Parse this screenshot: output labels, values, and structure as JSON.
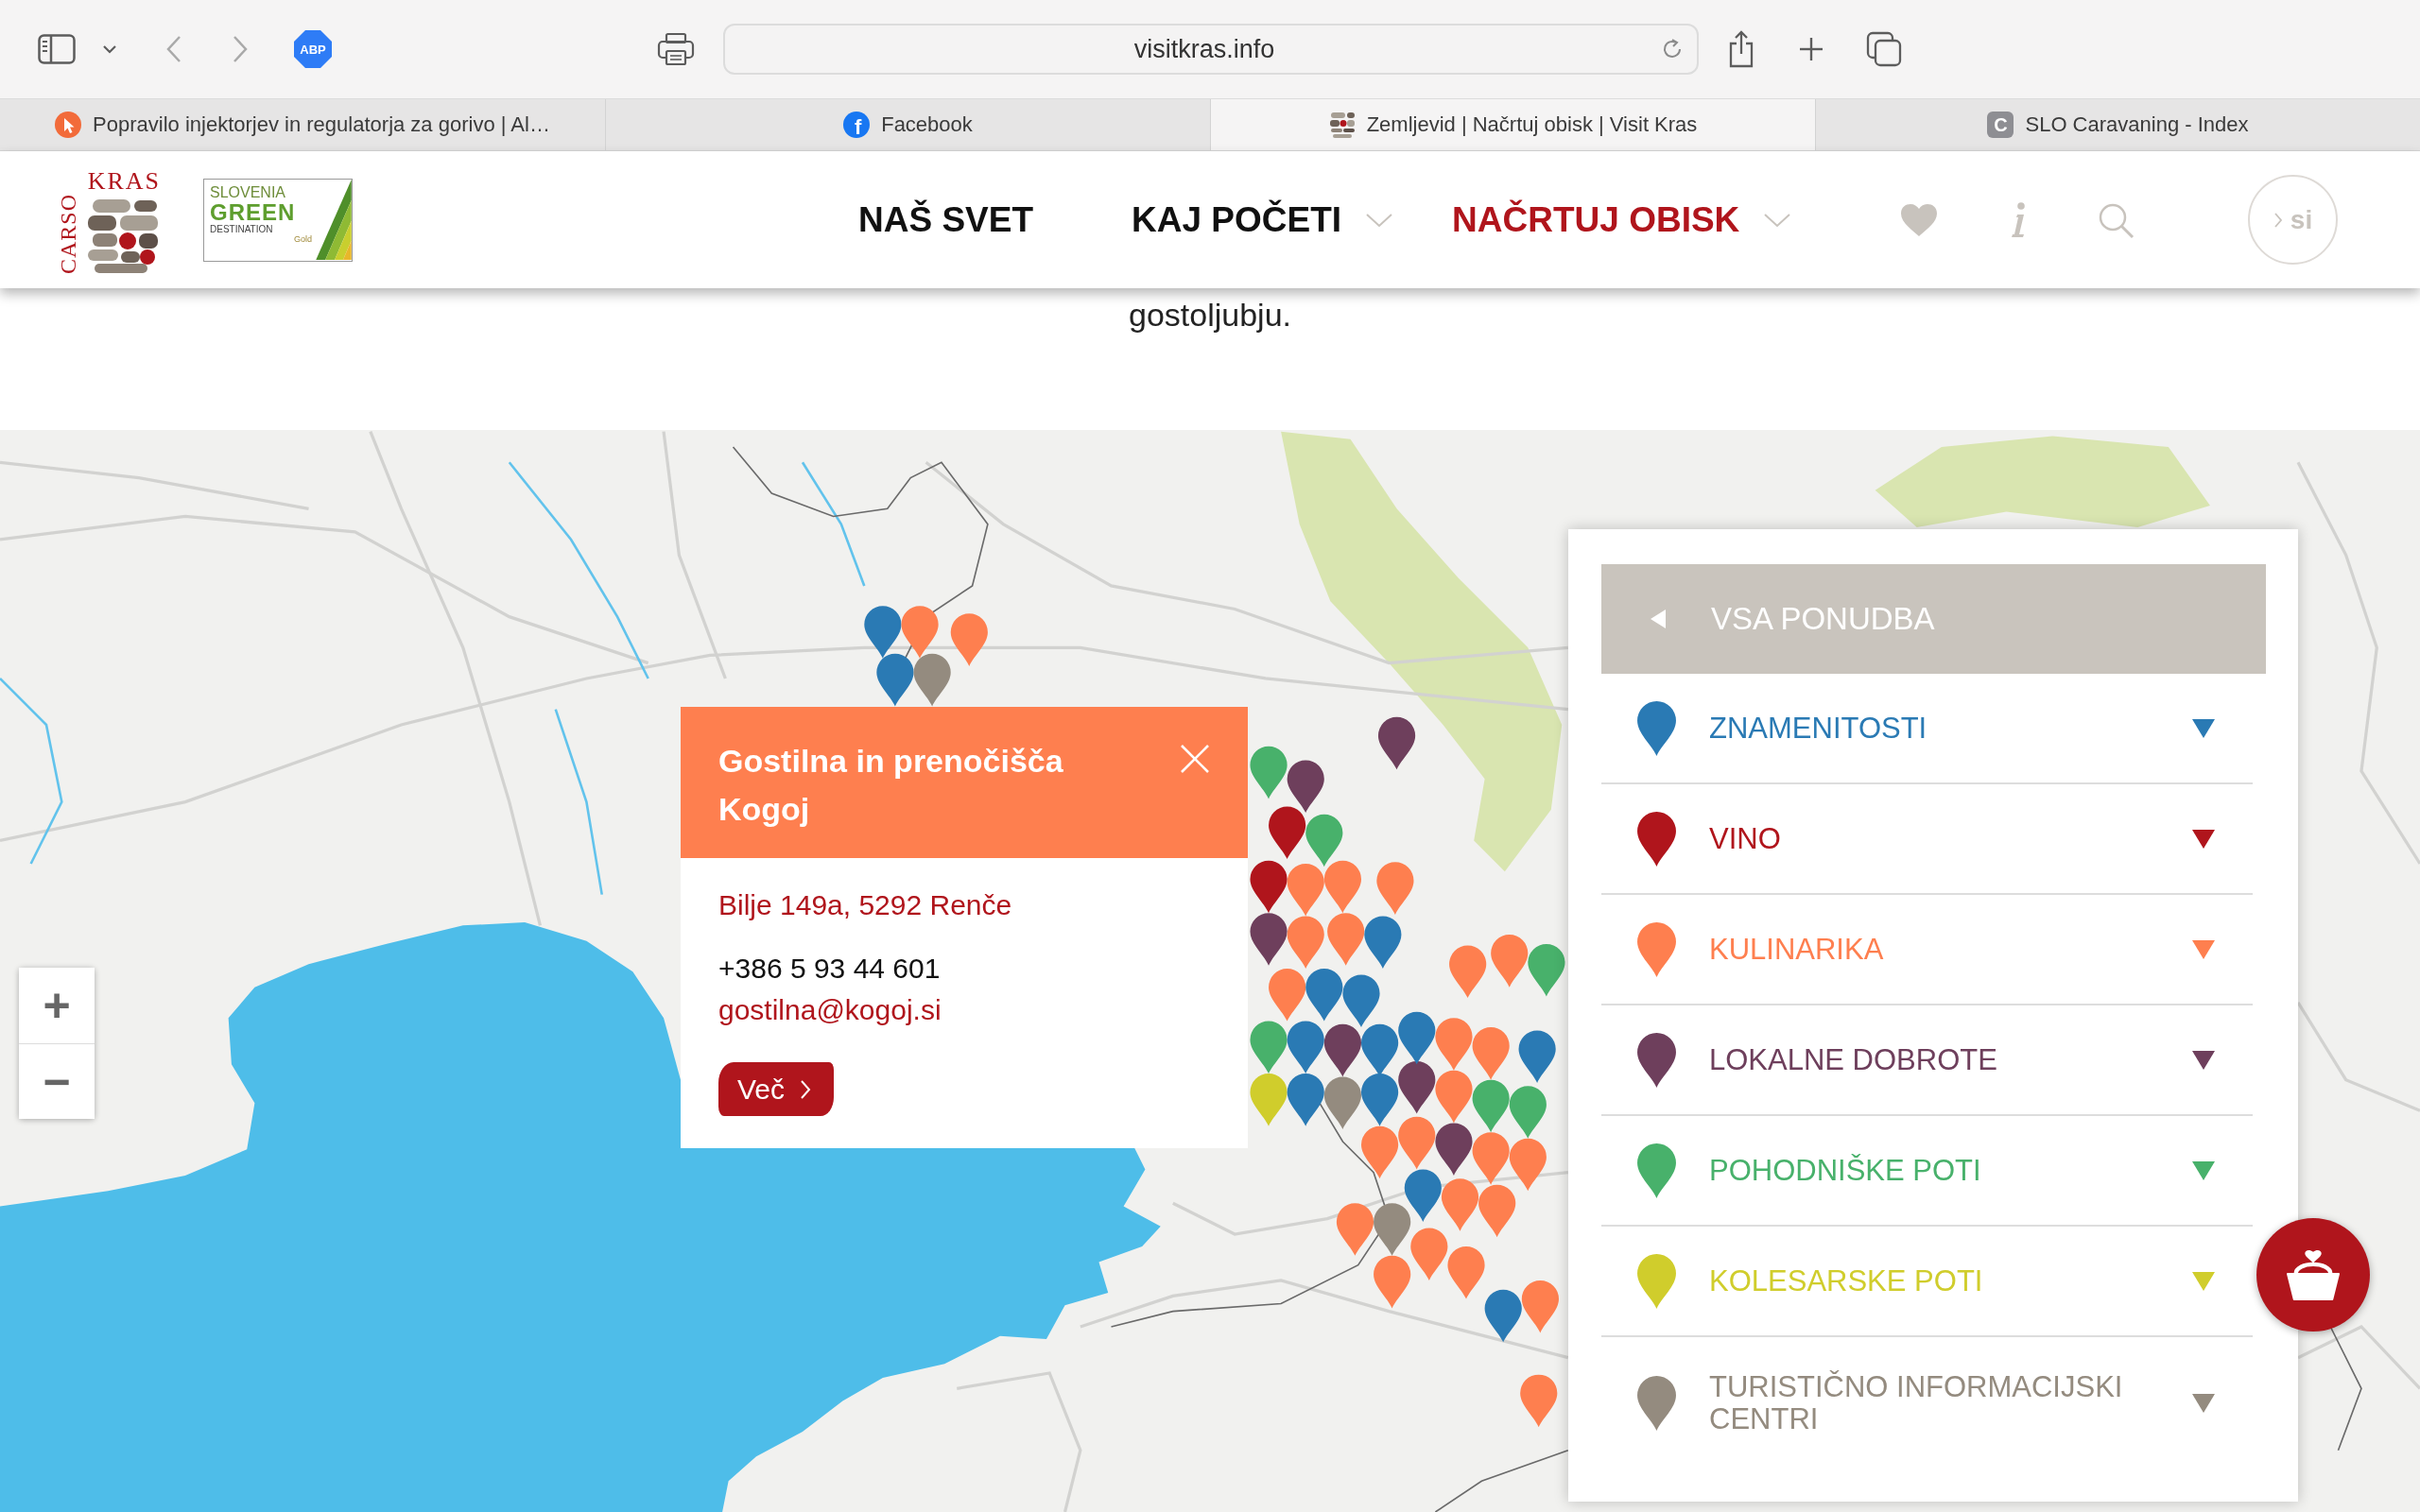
{
  "browser": {
    "toolbar": {
      "extension_badge": "ABP",
      "address": "visitkras.info"
    },
    "tabs": [
      {
        "title": "Popravilo injektorjev in regulatorja za gorivo | Al…",
        "selected": false,
        "favicon": {
          "kind": "cursor"
        }
      },
      {
        "title": "Facebook",
        "selected": false,
        "favicon": {
          "kind": "disc",
          "text": "f"
        }
      },
      {
        "title": "Zemljevid | Načrtuj obisk | Visit Kras",
        "selected": true,
        "favicon": {
          "kind": "stones"
        }
      },
      {
        "title": "SLO Caravaning - Index",
        "selected": false,
        "favicon": {
          "kind": "tile",
          "text": "C"
        }
      }
    ]
  },
  "site_header": {
    "logo": {
      "carso": "CARSO",
      "kras": "KRAS"
    },
    "green_logo": {
      "slovenia": "SLOVENIA",
      "green": "GREEN",
      "destination": "DESTINATION",
      "tier": "Gold"
    },
    "nav": [
      {
        "label": "NAŠ SVET",
        "selected": false,
        "dropdown": false
      },
      {
        "label": "KAJ POČETI",
        "selected": false,
        "dropdown": true
      },
      {
        "label": "NAČRTUJ OBISK",
        "selected": true,
        "dropdown": true
      }
    ],
    "language": "si"
  },
  "intro_text": "gostoljubju.",
  "map": {
    "zoom_controls": [
      "+",
      "−"
    ],
    "pins": [
      {
        "color": "#2a7ab4"
      },
      {
        "color": "#fe7f4f"
      },
      {
        "color": "#fe7f4f"
      },
      {
        "color": "#2a7ab4"
      },
      {
        "color": "#948b7f"
      },
      {
        "color": "#6e3f5c"
      },
      {
        "color": "#48b16b"
      },
      {
        "color": "#6e3f5c"
      },
      {
        "color": "#b0151c"
      },
      {
        "color": "#48b16b"
      },
      {
        "color": "#b0151c"
      },
      {
        "color": "#fe7f4f"
      },
      {
        "color": "#fe7f4f"
      },
      {
        "color": "#6e3f5c"
      },
      {
        "color": "#fe7f4f"
      },
      {
        "color": "#fe7f4f"
      },
      {
        "color": "#2a7ab4"
      },
      {
        "color": "#fe7f4f"
      },
      {
        "color": "#fe7f4f"
      },
      {
        "color": "#48b16b"
      },
      {
        "color": "#fe7f4f"
      },
      {
        "color": "#2a7ab4"
      },
      {
        "color": "#2a7ab4"
      },
      {
        "color": "#48b16b"
      },
      {
        "color": "#2a7ab4"
      },
      {
        "color": "#6e3f5c"
      },
      {
        "color": "#2a7ab4"
      },
      {
        "color": "#2a7ab4"
      },
      {
        "color": "#d0cd2c"
      },
      {
        "color": "#2a7ab4"
      },
      {
        "color": "#948b7f"
      },
      {
        "color": "#2a7ab4"
      },
      {
        "color": "#6e3f5c"
      },
      {
        "color": "#fe7f4f"
      },
      {
        "color": "#48b16b"
      },
      {
        "color": "#48b16b"
      },
      {
        "color": "#fe7f4f"
      },
      {
        "color": "#6e3f5c"
      },
      {
        "color": "#fe7f4f"
      },
      {
        "color": "#fe7f4f"
      },
      {
        "color": "#2a7ab4"
      },
      {
        "color": "#fe7f4f"
      },
      {
        "color": "#fe7f4f"
      },
      {
        "color": "#fe7f4f"
      },
      {
        "color": "#948b7f"
      },
      {
        "color": "#fe7f4f"
      },
      {
        "color": "#fe7f4f"
      },
      {
        "color": "#2a7ab4"
      },
      {
        "color": "#fe7f4f"
      },
      {
        "color": "#fe7f4f"
      },
      {
        "color": "#fe7f4f"
      },
      {
        "color": "#fe7f4f"
      },
      {
        "color": "#2a7ab4"
      },
      {
        "color": "#fe7f4f"
      },
      {
        "color": "#fe7f4f"
      },
      {
        "color": "#fe7f4f"
      }
    ],
    "popup": {
      "title": "Gostilna in prenočišča Kogoj",
      "address": "Bilje 149a, 5292 Renče",
      "phone": "+386 5 93 44 601",
      "email": "gostilna@kogoj.si",
      "more_button": "Več"
    },
    "category_panel": {
      "all_button": "VSA PONUDBA",
      "categories": [
        {
          "label": "ZNAMENITOSTI",
          "color": "#2a7ab4"
        },
        {
          "label": "VINO",
          "color": "#b0151c"
        },
        {
          "label": "KULINARIKA",
          "color": "#fe7f4f"
        },
        {
          "label": "LOKALNE DOBROTE",
          "color": "#6e3f5c"
        },
        {
          "label": "POHODNIŠKE POTI",
          "color": "#48b16b"
        },
        {
          "label": "KOLESARSKE POTI",
          "color": "#d0cd2c"
        },
        {
          "label": "TURISTIČNO INFORMACIJSKI CENTRI",
          "color": "#948b7f"
        }
      ]
    }
  }
}
